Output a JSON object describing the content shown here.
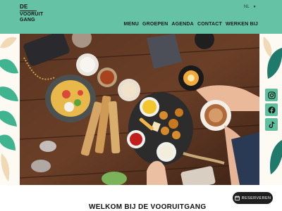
{
  "header": {
    "logo": {
      "line1": "DE",
      "line2": "VOORUIT",
      "line3": "GANG"
    },
    "language": {
      "selected": "NL"
    },
    "nav": [
      {
        "label": "MENU"
      },
      {
        "label": "GROEPEN"
      },
      {
        "label": "AGENDA"
      },
      {
        "label": "CONTACT"
      },
      {
        "label": "WERKEN BIJ"
      }
    ]
  },
  "hero": {
    "icon": "food-table-photo"
  },
  "social": [
    {
      "icon": "instagram-icon"
    },
    {
      "icon": "facebook-icon"
    },
    {
      "icon": "tiktok-icon"
    }
  ],
  "main": {
    "title": "WELKOM BIJ DE VOORUITGANG"
  },
  "reserve": {
    "label": "RESERVEREN"
  },
  "colors": {
    "brand": "#66c2a5",
    "dark": "#1f1f1f"
  }
}
